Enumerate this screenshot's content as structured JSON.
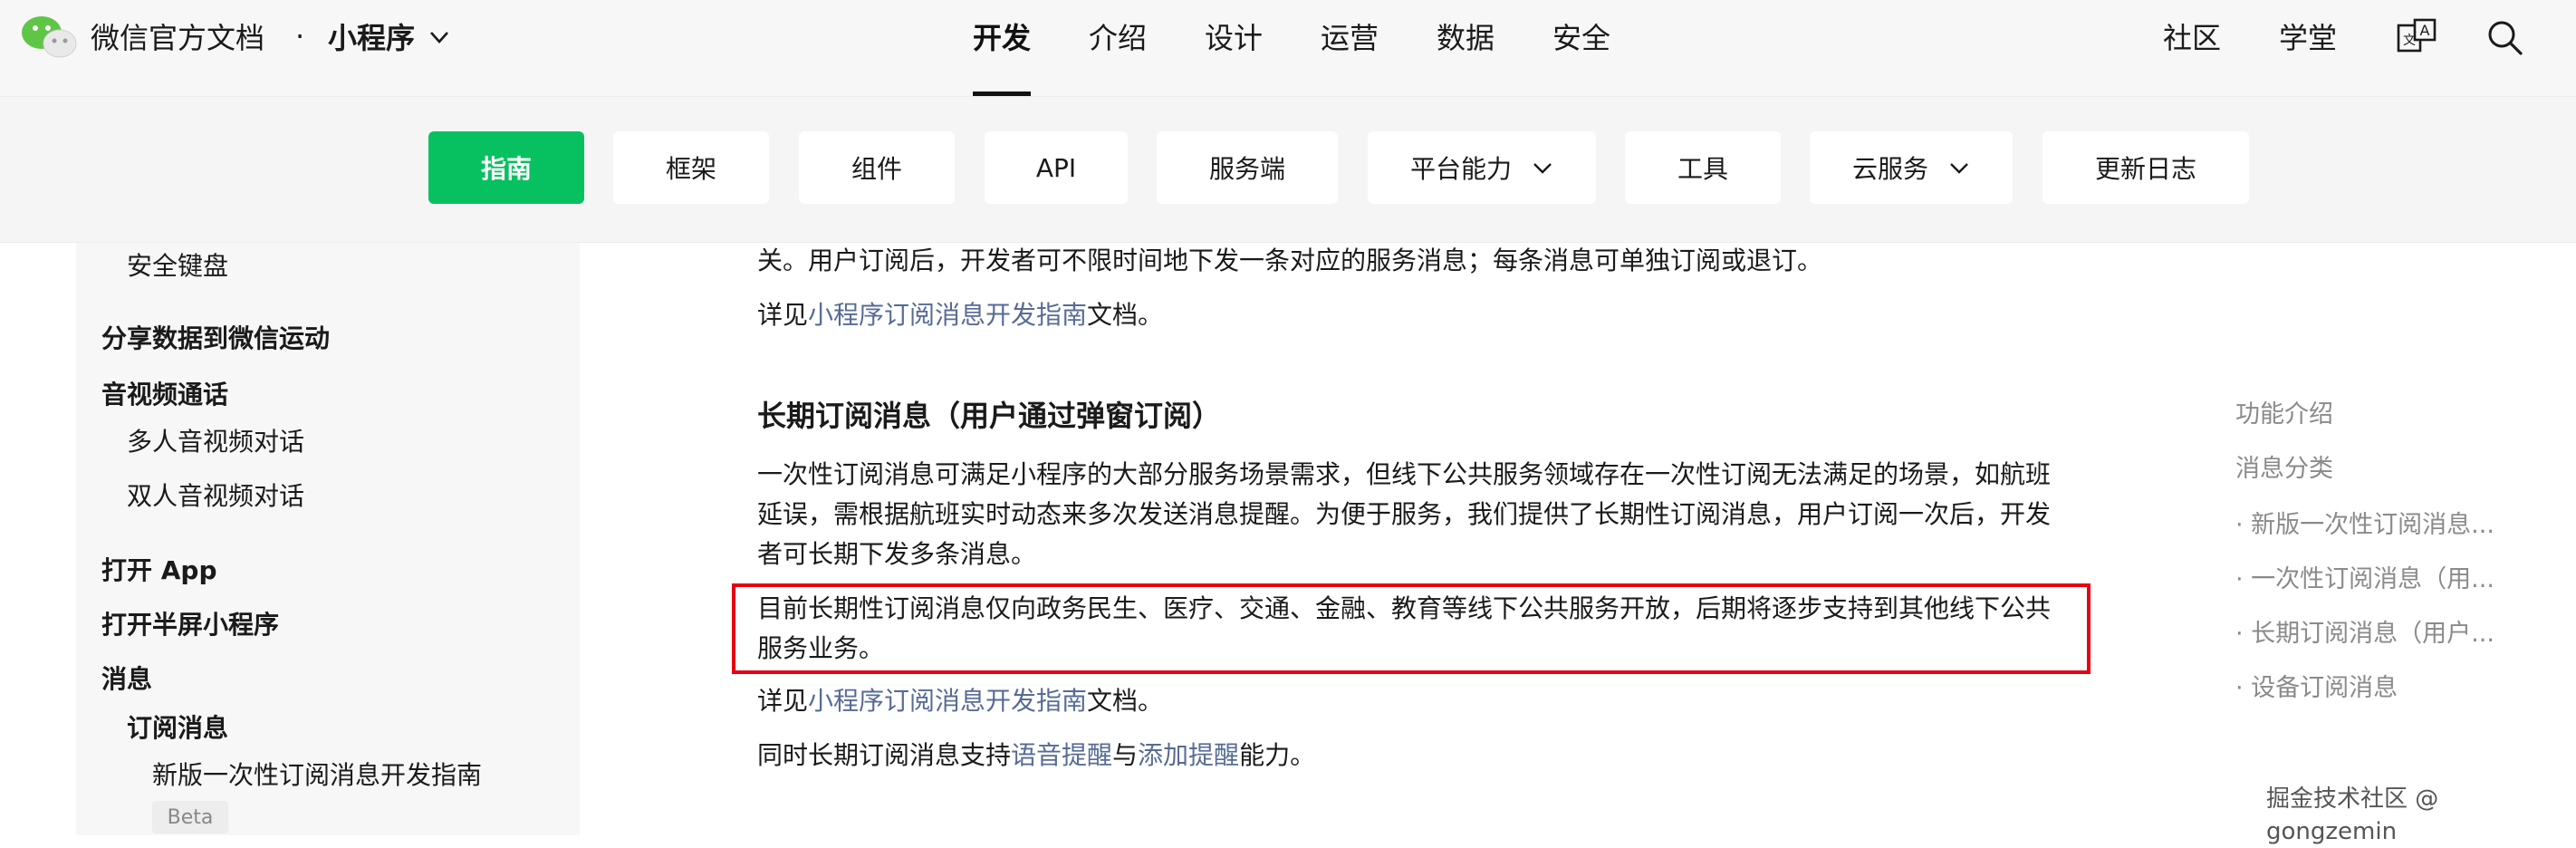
{
  "header": {
    "brand": "微信官方文档",
    "dot": "·",
    "product": "小程序",
    "nav": [
      "开发",
      "介绍",
      "设计",
      "运营",
      "数据",
      "安全"
    ],
    "right_links": [
      "社区",
      "学堂"
    ],
    "icons": [
      "logo-icon",
      "chevron-down-icon",
      "translate-icon",
      "search-icon"
    ]
  },
  "subnav": {
    "items": [
      "指南",
      "框架",
      "组件",
      "API",
      "服务端",
      "平台能力",
      "工具",
      "云服务",
      "更新日志"
    ],
    "active_index": 0,
    "accent": "#07c160"
  },
  "sidebar": {
    "items": [
      "安全键盘",
      "分享数据到微信运动",
      "音视频通话",
      "多人音视频对话",
      "双人音视频对话",
      "打开 App",
      "打开半屏小程序",
      "消息",
      "订阅消息",
      "新版一次性订阅消息开发指南"
    ],
    "badge": "Beta"
  },
  "content": {
    "p1": "关。用户订阅后，开发者可不限时间地下发一条对应的服务消息；每条消息可单独订阅或退订。",
    "p2_prefix": "详见",
    "p2_link": "小程序订阅消息开发指南",
    "p2_suffix": "文档。",
    "heading": "长期订阅消息（用户通过弹窗订阅）",
    "p3_lines": [
      "一次性订阅消息可满足小程序的大部分服务场景需求，但线下公共服务领域存在一次性订阅无法满足的场景，如航班",
      "延误，需根据航班实时动态来多次发送消息提醒。为便于服务，我们提供了长期性订阅消息，用户订阅一次后，开发",
      "者可长期下发多条消息。"
    ],
    "p4_lines": [
      "目前长期性订阅消息仅向政务民生、医疗、交通、金融、教育等线下公共服务开放，后期将逐步支持到其他线下公共",
      "服务业务。"
    ],
    "p5_prefix": "详见",
    "p5_link": "小程序订阅消息开发指南",
    "p5_suffix": "文档。",
    "p6_prefix": "同时长期订阅消息支持",
    "p6_link1": "语音提醒",
    "p6_mid": "与",
    "p6_link2": "添加提醒",
    "p6_suffix": "能力。",
    "highlight_color": "#e60012",
    "link_color": "#576b95"
  },
  "toc": {
    "items": [
      "功能介绍",
      "消息分类",
      "· 新版一次性订阅消息...",
      "· 一次性订阅消息（用...",
      "· 长期订阅消息（用户...",
      "· 设备订阅消息"
    ]
  },
  "watermark": "掘金技术社区 @ gongzemin"
}
